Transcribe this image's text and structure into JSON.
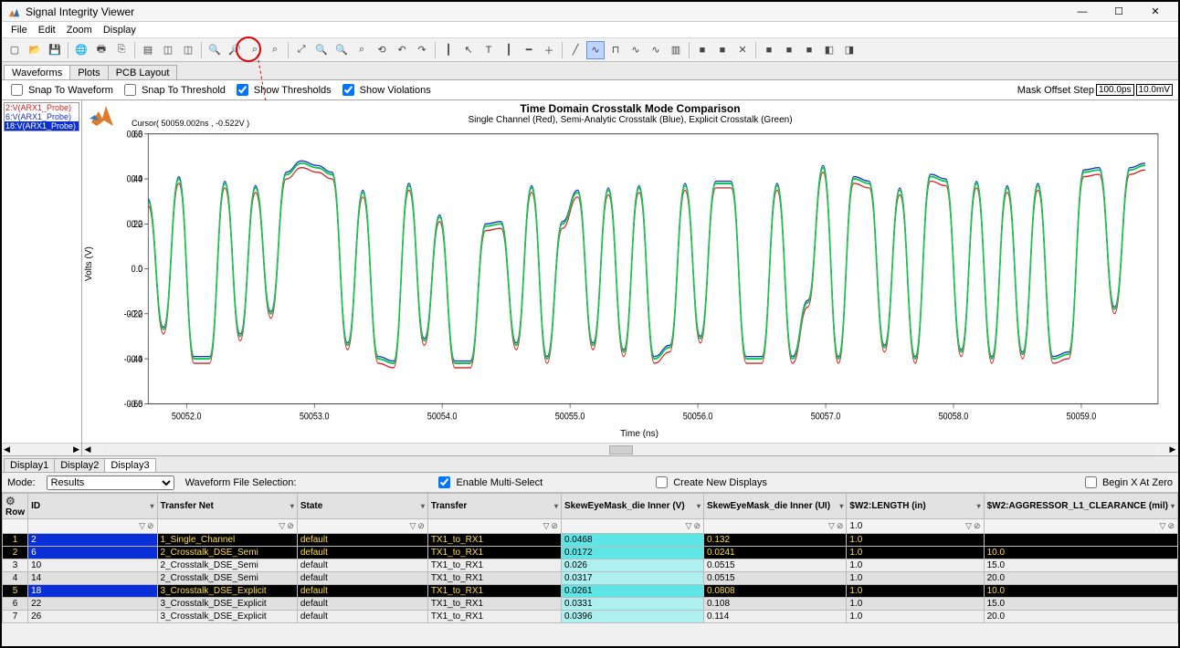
{
  "window": {
    "title": "Signal Integrity Viewer"
  },
  "menu": [
    "File",
    "Edit",
    "Zoom",
    "Display"
  ],
  "toolbar_icons": [
    "new",
    "open",
    "save",
    "globe",
    "print",
    "copy",
    "sheet",
    "dup1",
    "dup2",
    "zoom-in",
    "zoom-out",
    "zoom-area",
    "zoom-area2",
    "zoom-fit",
    "zoom-x",
    "zoom-y",
    "zoom-sel",
    "zoom-reset",
    "step-back",
    "step-fwd",
    "marker-h",
    "cursor",
    "text",
    "ruler-v",
    "ruler-h",
    "crosshair",
    "slash",
    "wave",
    "pulse",
    "wave2",
    "wave3",
    "chart",
    "sq1",
    "sq2",
    "close",
    "sq3",
    "sq4",
    "sq5",
    "cube",
    "cube2"
  ],
  "toolbar_highlight_index": 15,
  "tabs": {
    "items": [
      "Waveforms",
      "Plots",
      "PCB Layout"
    ],
    "active": 0
  },
  "options": {
    "snap_waveform": "Snap To Waveform",
    "snap_threshold": "Snap To Threshold",
    "show_thresholds": "Show Thresholds",
    "show_violations": "Show Violations",
    "mask_label": "Mask Offset Step",
    "mask_t": "100.0ps",
    "mask_v": "10.0mV"
  },
  "probes": [
    {
      "label": "2:V(ARX1_Probe)",
      "color": "#d62222"
    },
    {
      "label": "6:V(ARX1_Probe)",
      "color": "#1830d0"
    },
    {
      "label": "18:V(ARX1_Probe)",
      "color": "#11a85a",
      "bg": "#0a2fd6",
      "fg": "#fff"
    }
  ],
  "plot": {
    "title": "Time Domain Crosstalk Mode Comparison",
    "subtitle": "Single Channel (Red), Semi-Analytic Crosstalk (Blue), Explicit Crosstalk (Green)",
    "cursor": "Cursor( 50059.002ns , -0.522V )",
    "ylabel": "Volts (V)",
    "xlabel": "Time (ns)",
    "yticks": [
      "0.60",
      "0.40",
      "0.20",
      "0.0",
      "-0.20",
      "-0.40",
      "-0.60"
    ],
    "xticks": [
      "50052.0",
      "50053.0",
      "50054.0",
      "50055.0",
      "50056.0",
      "50057.0",
      "50058.0",
      "50059.0"
    ]
  },
  "chart_data": {
    "type": "line",
    "xlabel": "Time (ns)",
    "ylabel": "Volts (V)",
    "xlim": [
      50051.7,
      50059.6
    ],
    "ylim": [
      -0.6,
      0.6
    ],
    "xticks": [
      50052.0,
      50053.0,
      50054.0,
      50055.0,
      50056.0,
      50057.0,
      50058.0,
      50059.0
    ],
    "yticks": [
      -0.6,
      -0.4,
      -0.2,
      0.0,
      0.2,
      0.4,
      0.6
    ],
    "series": [
      {
        "name": "Single Channel",
        "color": "#d62222"
      },
      {
        "name": "Semi-Analytic Crosstalk",
        "color": "#1830d0"
      },
      {
        "name": "Explicit Crosstalk",
        "color": "#11c84d"
      }
    ],
    "x": [
      50051.7,
      50051.82,
      50051.94,
      50052.06,
      50052.18,
      50052.3,
      50052.42,
      50052.54,
      50052.66,
      50052.78,
      50052.9,
      50053.02,
      50053.14,
      50053.26,
      50053.38,
      50053.5,
      50053.62,
      50053.74,
      50053.86,
      50053.98,
      50054.1,
      50054.22,
      50054.34,
      50054.46,
      50054.58,
      50054.7,
      50054.82,
      50054.94,
      50055.06,
      50055.18,
      50055.3,
      50055.42,
      50055.54,
      50055.66,
      50055.78,
      50055.9,
      50056.02,
      50056.14,
      50056.26,
      50056.38,
      50056.5,
      50056.62,
      50056.74,
      50056.86,
      50056.98,
      50057.1,
      50057.22,
      50057.34,
      50057.46,
      50057.58,
      50057.7,
      50057.82,
      50057.94,
      50058.06,
      50058.18,
      50058.3,
      50058.42,
      50058.54,
      50058.66,
      50058.78,
      50058.9,
      50059.02,
      50059.14,
      50059.26,
      50059.38,
      50059.5
    ],
    "y": [
      0.3,
      -0.27,
      0.4,
      -0.4,
      -0.4,
      0.38,
      -0.3,
      0.36,
      -0.2,
      0.42,
      0.47,
      0.45,
      0.42,
      -0.34,
      0.34,
      -0.4,
      -0.42,
      0.37,
      -0.32,
      0.23,
      -0.42,
      -0.42,
      0.19,
      0.2,
      -0.34,
      0.36,
      -0.4,
      0.2,
      0.34,
      -0.34,
      0.35,
      -0.37,
      0.36,
      -0.4,
      -0.35,
      0.37,
      -0.31,
      0.38,
      0.38,
      -0.4,
      -0.4,
      0.37,
      -0.4,
      -0.15,
      0.45,
      -0.4,
      0.4,
      0.38,
      -0.35,
      0.35,
      -0.4,
      0.41,
      0.39,
      -0.37,
      0.38,
      -0.4,
      0.36,
      -0.38,
      0.37,
      -0.4,
      -0.38,
      0.43,
      0.44,
      -0.18,
      0.44,
      0.46
    ],
    "note": "Three overlaid series are nearly identical; green dominates visually. The y array approximates the common waveform."
  },
  "display_tabs": {
    "items": [
      "Display1",
      "Display2",
      "Display3"
    ],
    "active": 2
  },
  "bottom": {
    "mode_label": "Mode:",
    "mode_value": "Results",
    "wfs_label": "Waveform File Selection:",
    "enable_multi": "Enable Multi-Select",
    "create_new": "Create New Displays",
    "begin_zero": "Begin X At Zero"
  },
  "columns": [
    "Row",
    "ID",
    "Transfer Net",
    "State",
    "Transfer",
    "SkewEyeMask_die Inner (V)",
    "SkewEyeMask_die Inner (UI)",
    "$W2:LENGTH (in)",
    "$W2:AGGRESSOR_L1_CLEARANCE (mil)"
  ],
  "filter_defaults": [
    "",
    "",
    "",
    "",
    "",
    "",
    "",
    "1.0",
    ""
  ],
  "rows": [
    {
      "sel": true,
      "n": "1",
      "id": "2",
      "net": "1_Single_Channel",
      "state": "default",
      "xfer": "TX1_to_RX1",
      "v": "0.0468",
      "ui": "0.132",
      "len": "1.0",
      "clr": ""
    },
    {
      "sel": true,
      "n": "2",
      "id": "6",
      "net": "2_Crosstalk_DSE_Semi",
      "state": "default",
      "xfer": "TX1_to_RX1",
      "v": "0.0172",
      "ui": "0.0241",
      "len": "1.0",
      "clr": "10.0"
    },
    {
      "sel": false,
      "n": "3",
      "id": "10",
      "net": "2_Crosstalk_DSE_Semi",
      "state": "default",
      "xfer": "TX1_to_RX1",
      "v": "0.026",
      "ui": "0.0515",
      "len": "1.0",
      "clr": "15.0"
    },
    {
      "sel": false,
      "n": "4",
      "id": "14",
      "net": "2_Crosstalk_DSE_Semi",
      "state": "default",
      "xfer": "TX1_to_RX1",
      "v": "0.0317",
      "ui": "0.0515",
      "len": "1.0",
      "clr": "20.0"
    },
    {
      "sel": true,
      "n": "5",
      "id": "18",
      "net": "3_Crosstalk_DSE_Explicit",
      "state": "default",
      "xfer": "TX1_to_RX1",
      "v": "0.0261",
      "ui": "0.0808",
      "len": "1.0",
      "clr": "10.0"
    },
    {
      "sel": false,
      "n": "6",
      "id": "22",
      "net": "3_Crosstalk_DSE_Explicit",
      "state": "default",
      "xfer": "TX1_to_RX1",
      "v": "0.0331",
      "ui": "0.108",
      "len": "1.0",
      "clr": "15.0"
    },
    {
      "sel": false,
      "n": "7",
      "id": "26",
      "net": "3_Crosstalk_DSE_Explicit",
      "state": "default",
      "xfer": "TX1_to_RX1",
      "v": "0.0396",
      "ui": "0.114",
      "len": "1.0",
      "clr": "20.0"
    }
  ]
}
